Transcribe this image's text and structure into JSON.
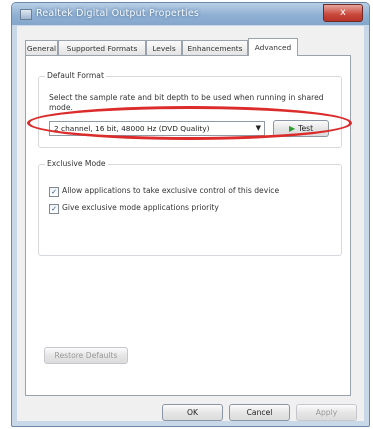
{
  "window": {
    "title": "Realtek Digital Output Properties",
    "close_label": "x"
  },
  "tabs": [
    {
      "label": "General"
    },
    {
      "label": "Supported Formats"
    },
    {
      "label": "Levels"
    },
    {
      "label": "Enhancements"
    },
    {
      "label": "Advanced"
    }
  ],
  "active_tab": "Advanced",
  "default_format": {
    "legend": "Default Format",
    "description": "Select the sample rate and bit depth to be used when running in shared mode.",
    "selected_value": "2 channel, 16 bit, 48000 Hz (DVD Quality)",
    "test_label": "Test"
  },
  "exclusive_mode": {
    "legend": "Exclusive Mode",
    "allow_label": "Allow applications to take exclusive control of this device",
    "allow_checked": true,
    "priority_label": "Give exclusive mode applications priority",
    "priority_checked": true
  },
  "restore_defaults_label": "Restore Defaults",
  "footer": {
    "ok_label": "OK",
    "cancel_label": "Cancel",
    "apply_label": "Apply"
  },
  "colors": {
    "highlight": "#dc2b2b",
    "test_icon": "#2e9a2e"
  },
  "icons": {
    "title": "speaker-icon",
    "test": "play-icon",
    "dropdown": "chevron-down-icon"
  }
}
